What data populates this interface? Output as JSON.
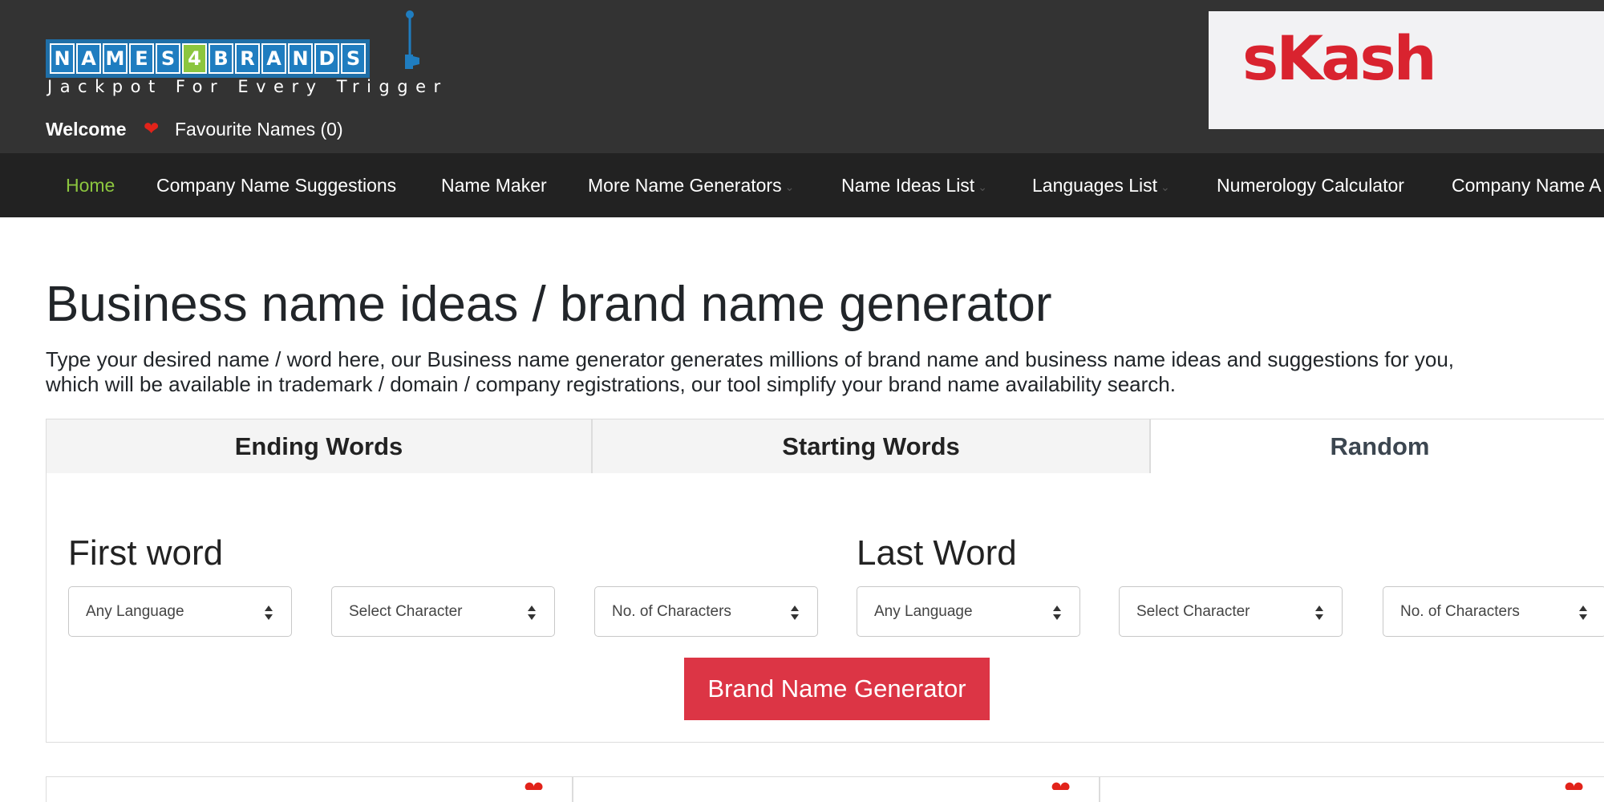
{
  "header": {
    "logo_letters": [
      "N",
      "A",
      "M",
      "E",
      "S",
      "4",
      "B",
      "R",
      "A",
      "N",
      "D",
      "S"
    ],
    "logo_tagline": "Jackpot For Every Trigger",
    "welcome": "Welcome",
    "favourites_icon": "heart-icon",
    "favourites": "Favourite Names (0)",
    "ad_brand": "sKash",
    "colors": {
      "header_bg": "#333333",
      "nav_bg": "#222222",
      "logo_blue": "#1f7dc0",
      "logo_green": "#8cc63f",
      "ad_red": "#d9232f"
    }
  },
  "nav": {
    "items": [
      {
        "label": "Home",
        "active": true
      },
      {
        "label": "Company Name Suggestions"
      },
      {
        "label": "Name Maker"
      },
      {
        "label": "More Name Generators",
        "dropdown": true
      },
      {
        "label": "Name Ideas List",
        "dropdown": true
      },
      {
        "label": "Languages List",
        "dropdown": true
      },
      {
        "label": "Numerology Calculator"
      },
      {
        "label": "Company Name A"
      }
    ],
    "caret_icon": "chevron-down-icon"
  },
  "main": {
    "title": "Business name ideas / brand name generator",
    "intro_line1": "Type your desired name / word here, our Business name generator generates millions of brand name and business name ideas and suggestions for you,",
    "intro_line2": "which will be available in trademark / domain / company registrations, our tool simplify your brand name availability search.",
    "tabs": [
      {
        "label": "Ending Words"
      },
      {
        "label": "Starting Words"
      },
      {
        "label": "Random",
        "active": true
      }
    ],
    "first_word": {
      "heading": "First word",
      "selects": [
        {
          "value": "Any Language"
        },
        {
          "value": "Select Character"
        },
        {
          "value": "No. of Characters"
        }
      ]
    },
    "last_word": {
      "heading": "Last Word",
      "selects": [
        {
          "value": "Any Language"
        },
        {
          "value": "Select Character"
        },
        {
          "value": "No. of Characters"
        }
      ]
    },
    "generate_button": "Brand Name Generator",
    "result_card_icon": "heart-icon",
    "accent_color": "#dc3545"
  }
}
